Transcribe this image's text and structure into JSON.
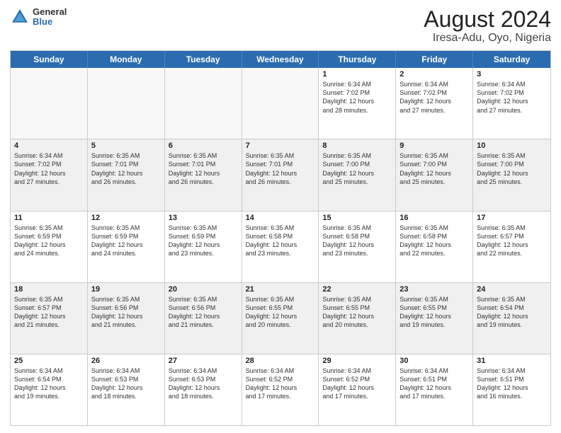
{
  "logo": {
    "general": "General",
    "blue": "Blue"
  },
  "title": "August 2024",
  "subtitle": "Iresa-Adu, Oyo, Nigeria",
  "weekdays": [
    "Sunday",
    "Monday",
    "Tuesday",
    "Wednesday",
    "Thursday",
    "Friday",
    "Saturday"
  ],
  "rows": [
    [
      {
        "day": "",
        "text": "",
        "empty": true
      },
      {
        "day": "",
        "text": "",
        "empty": true
      },
      {
        "day": "",
        "text": "",
        "empty": true
      },
      {
        "day": "",
        "text": "",
        "empty": true
      },
      {
        "day": "1",
        "text": "Sunrise: 6:34 AM\nSunset: 7:02 PM\nDaylight: 12 hours\nand 28 minutes."
      },
      {
        "day": "2",
        "text": "Sunrise: 6:34 AM\nSunset: 7:02 PM\nDaylight: 12 hours\nand 27 minutes."
      },
      {
        "day": "3",
        "text": "Sunrise: 6:34 AM\nSunset: 7:02 PM\nDaylight: 12 hours\nand 27 minutes."
      }
    ],
    [
      {
        "day": "4",
        "text": "Sunrise: 6:34 AM\nSunset: 7:02 PM\nDaylight: 12 hours\nand 27 minutes."
      },
      {
        "day": "5",
        "text": "Sunrise: 6:35 AM\nSunset: 7:01 PM\nDaylight: 12 hours\nand 26 minutes."
      },
      {
        "day": "6",
        "text": "Sunrise: 6:35 AM\nSunset: 7:01 PM\nDaylight: 12 hours\nand 26 minutes."
      },
      {
        "day": "7",
        "text": "Sunrise: 6:35 AM\nSunset: 7:01 PM\nDaylight: 12 hours\nand 26 minutes."
      },
      {
        "day": "8",
        "text": "Sunrise: 6:35 AM\nSunset: 7:00 PM\nDaylight: 12 hours\nand 25 minutes."
      },
      {
        "day": "9",
        "text": "Sunrise: 6:35 AM\nSunset: 7:00 PM\nDaylight: 12 hours\nand 25 minutes."
      },
      {
        "day": "10",
        "text": "Sunrise: 6:35 AM\nSunset: 7:00 PM\nDaylight: 12 hours\nand 25 minutes."
      }
    ],
    [
      {
        "day": "11",
        "text": "Sunrise: 6:35 AM\nSunset: 6:59 PM\nDaylight: 12 hours\nand 24 minutes."
      },
      {
        "day": "12",
        "text": "Sunrise: 6:35 AM\nSunset: 6:59 PM\nDaylight: 12 hours\nand 24 minutes."
      },
      {
        "day": "13",
        "text": "Sunrise: 6:35 AM\nSunset: 6:59 PM\nDaylight: 12 hours\nand 23 minutes."
      },
      {
        "day": "14",
        "text": "Sunrise: 6:35 AM\nSunset: 6:58 PM\nDaylight: 12 hours\nand 23 minutes."
      },
      {
        "day": "15",
        "text": "Sunrise: 6:35 AM\nSunset: 6:58 PM\nDaylight: 12 hours\nand 23 minutes."
      },
      {
        "day": "16",
        "text": "Sunrise: 6:35 AM\nSunset: 6:58 PM\nDaylight: 12 hours\nand 22 minutes."
      },
      {
        "day": "17",
        "text": "Sunrise: 6:35 AM\nSunset: 6:57 PM\nDaylight: 12 hours\nand 22 minutes."
      }
    ],
    [
      {
        "day": "18",
        "text": "Sunrise: 6:35 AM\nSunset: 6:57 PM\nDaylight: 12 hours\nand 21 minutes."
      },
      {
        "day": "19",
        "text": "Sunrise: 6:35 AM\nSunset: 6:56 PM\nDaylight: 12 hours\nand 21 minutes."
      },
      {
        "day": "20",
        "text": "Sunrise: 6:35 AM\nSunset: 6:56 PM\nDaylight: 12 hours\nand 21 minutes."
      },
      {
        "day": "21",
        "text": "Sunrise: 6:35 AM\nSunset: 6:55 PM\nDaylight: 12 hours\nand 20 minutes."
      },
      {
        "day": "22",
        "text": "Sunrise: 6:35 AM\nSunset: 6:55 PM\nDaylight: 12 hours\nand 20 minutes."
      },
      {
        "day": "23",
        "text": "Sunrise: 6:35 AM\nSunset: 6:55 PM\nDaylight: 12 hours\nand 19 minutes."
      },
      {
        "day": "24",
        "text": "Sunrise: 6:35 AM\nSunset: 6:54 PM\nDaylight: 12 hours\nand 19 minutes."
      }
    ],
    [
      {
        "day": "25",
        "text": "Sunrise: 6:34 AM\nSunset: 6:54 PM\nDaylight: 12 hours\nand 19 minutes."
      },
      {
        "day": "26",
        "text": "Sunrise: 6:34 AM\nSunset: 6:53 PM\nDaylight: 12 hours\nand 18 minutes."
      },
      {
        "day": "27",
        "text": "Sunrise: 6:34 AM\nSunset: 6:53 PM\nDaylight: 12 hours\nand 18 minutes."
      },
      {
        "day": "28",
        "text": "Sunrise: 6:34 AM\nSunset: 6:52 PM\nDaylight: 12 hours\nand 17 minutes."
      },
      {
        "day": "29",
        "text": "Sunrise: 6:34 AM\nSunset: 6:52 PM\nDaylight: 12 hours\nand 17 minutes."
      },
      {
        "day": "30",
        "text": "Sunrise: 6:34 AM\nSunset: 6:51 PM\nDaylight: 12 hours\nand 17 minutes."
      },
      {
        "day": "31",
        "text": "Sunrise: 6:34 AM\nSunset: 6:51 PM\nDaylight: 12 hours\nand 16 minutes."
      }
    ]
  ]
}
